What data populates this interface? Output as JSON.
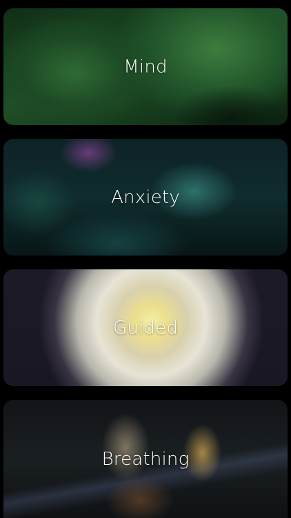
{
  "categories": [
    {
      "id": "mind",
      "label": "Mind"
    },
    {
      "id": "anxiety",
      "label": "Anxiety"
    },
    {
      "id": "guided",
      "label": "Guided"
    },
    {
      "id": "breathing",
      "label": "Breathing"
    }
  ]
}
